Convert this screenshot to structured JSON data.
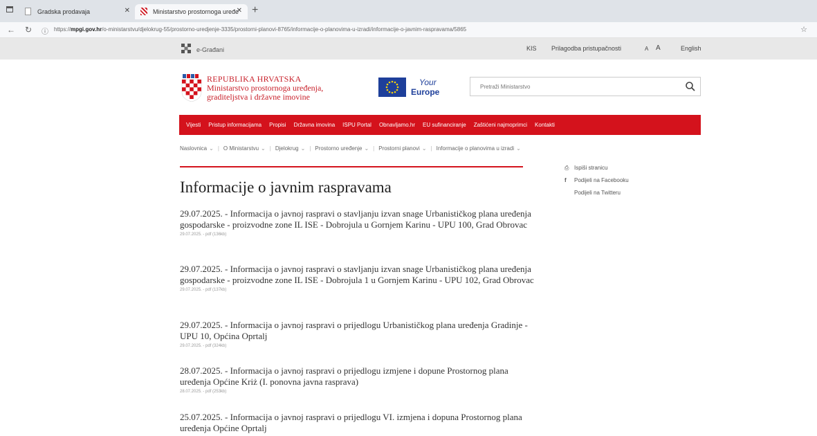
{
  "browser": {
    "tabs": [
      {
        "label": "Gradska prodavaja"
      },
      {
        "label": "Ministarstvo prostornoga uređe"
      }
    ],
    "url_prefix": "https://",
    "url_host": "mpgi.gov.hr",
    "url_path": "/o-ministarstvu/djelokrug-55/prostorno-uredjenje-3335/prostorni-planovi-8765/informacije-o-planovima-u-izradi/informacije-o-javnim-raspravama/5865"
  },
  "util": {
    "egradjani": "e-Građani",
    "links": [
      "KIS",
      "Prilagodba pristupačnosti",
      "A",
      "A",
      "English"
    ]
  },
  "brand": {
    "line1": "REPUBLIKA HRVATSKA",
    "line2": "Ministarstvo prostornoga uređenja,",
    "line3": "graditeljstva i državne imovine",
    "eu_your": "Your",
    "eu_europe": "Europe"
  },
  "search": {
    "placeholder": "Pretraži Ministarstvo"
  },
  "nav": [
    "Vijesti",
    "Pristup informacijama",
    "Propisi",
    "Državna imovina",
    "ISPU Portal",
    "Obnavljamo.hr",
    "EU sufinanciranje",
    "Zaštićeni najmoprimci",
    "Kontakti"
  ],
  "breadcrumb": [
    "Naslovnica",
    "O Ministarstvu",
    "Djelokrug",
    "Prostorno uređenje",
    "Prostorni planovi",
    "Informacije o planovima u izradi"
  ],
  "page": {
    "title": "Informacije o javnim raspravama"
  },
  "side": {
    "print": "Ispiši stranicu",
    "facebook": "Podijeli na Facebooku",
    "twitter": "Podijeli na Twitteru"
  },
  "items": [
    {
      "title": "29.07.2025. - Informacija o javnoj raspravi o stavljanju izvan snage Urbanističkog plana uređenja gospodarske - proizvodne zone IL ISE - Dobrojula u Gornjem Karinu - UPU 100, Grad Obrovac",
      "meta": "29.07.2025. - pdf (136kb)"
    },
    {
      "title": "29.07.2025. - Informacija o javnoj raspravi o stavljanju izvan snage Urbanističkog plana uređenja gospodarske - proizvodne zone IL ISE - Dobrojula 1 u Gornjem Karinu - UPU 102, Grad Obrovac",
      "meta": "29.07.2025. - pdf (137kb)"
    },
    {
      "title": "29.07.2025. - Informacija o javnoj raspravi o prijedlogu Urbanističkog plana uređenja Gradinje - UPU 10, Općina Oprtalj",
      "meta": "29.07.2025. - pdf (324kb)"
    },
    {
      "title": "28.07.2025. - Informacija o javnoj raspravi o prijedlogu izmjene i dopune Prostornog plana uređenja Općine Kriż (I. ponovna javna rasprava)",
      "meta": "28.07.2025. - pdf (253kb)"
    },
    {
      "title": "25.07.2025. - Informacija o javnoj raspravi o prijedlogu VI. izmjena i dopuna Prostornog plana uređenja Općine Oprtalj",
      "meta": ""
    }
  ]
}
